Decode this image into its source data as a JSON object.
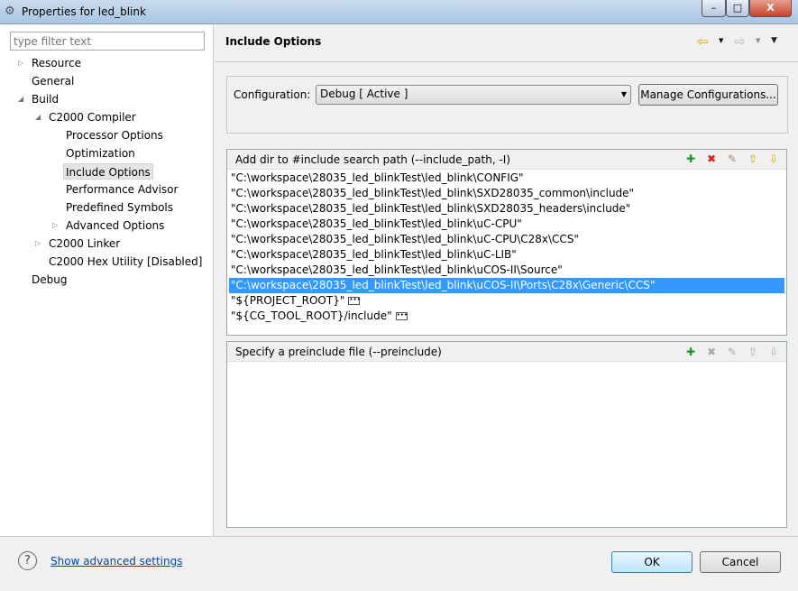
{
  "window": {
    "title": "Properties for led_blink",
    "minimize": "–",
    "maximize": "□",
    "close": "X"
  },
  "sidebar": {
    "filter_placeholder": "type filter text",
    "items": [
      {
        "label": "Resource",
        "level": 0,
        "twisty": "▷"
      },
      {
        "label": "General",
        "level": 0,
        "twisty": ""
      },
      {
        "label": "Build",
        "level": 0,
        "twisty": "◢"
      },
      {
        "label": "C2000 Compiler",
        "level": 1,
        "twisty": "◢"
      },
      {
        "label": "Processor Options",
        "level": 2,
        "twisty": ""
      },
      {
        "label": "Optimization",
        "level": 2,
        "twisty": ""
      },
      {
        "label": "Include Options",
        "level": 2,
        "twisty": "",
        "selected": true
      },
      {
        "label": "Performance Advisor",
        "level": 2,
        "twisty": ""
      },
      {
        "label": "Predefined Symbols",
        "level": 2,
        "twisty": ""
      },
      {
        "label": "Advanced Options",
        "level": 2,
        "twisty": "▷"
      },
      {
        "label": "C2000 Linker",
        "level": 1,
        "twisty": "▷"
      },
      {
        "label": "C2000 Hex Utility  [Disabled]",
        "level": 1,
        "twisty": ""
      },
      {
        "label": "Debug",
        "level": 0,
        "twisty": ""
      }
    ]
  },
  "header": {
    "title": "Include Options",
    "back": "⇦",
    "forward": "⇨",
    "menu": "▼"
  },
  "config": {
    "label": "Configuration:",
    "value": "Debug  [ Active ]",
    "manage": "Manage Configurations..."
  },
  "include": {
    "title": "Add dir to #include search path (--include_path, -I)",
    "selected_index": 7,
    "paths": [
      "\"C:\\workspace\\28035_led_blinkTest\\led_blink\\CONFIG\"",
      "\"C:\\workspace\\28035_led_blinkTest\\led_blink\\SXD28035_common\\include\"",
      "\"C:\\workspace\\28035_led_blinkTest\\led_blink\\SXD28035_headers\\include\"",
      "\"C:\\workspace\\28035_led_blinkTest\\led_blink\\uC-CPU\"",
      "\"C:\\workspace\\28035_led_blinkTest\\led_blink\\uC-CPU\\C28x\\CCS\"",
      "\"C:\\workspace\\28035_led_blinkTest\\led_blink\\uC-LIB\"",
      "\"C:\\workspace\\28035_led_blinkTest\\led_blink\\uCOS-II\\Source\"",
      "\"C:\\workspace\\28035_led_blinkTest\\led_blink\\uCOS-II\\Ports\\C28x\\Generic\\CCS\"",
      "\"${PROJECT_ROOT}\"",
      "\"${CG_TOOL_ROOT}/include\""
    ]
  },
  "preinclude": {
    "title": "Specify a preinclude file (--preinclude)"
  },
  "footer": {
    "help": "?",
    "advanced_link": "Show advanced settings",
    "ok": "OK",
    "cancel": "Cancel"
  }
}
